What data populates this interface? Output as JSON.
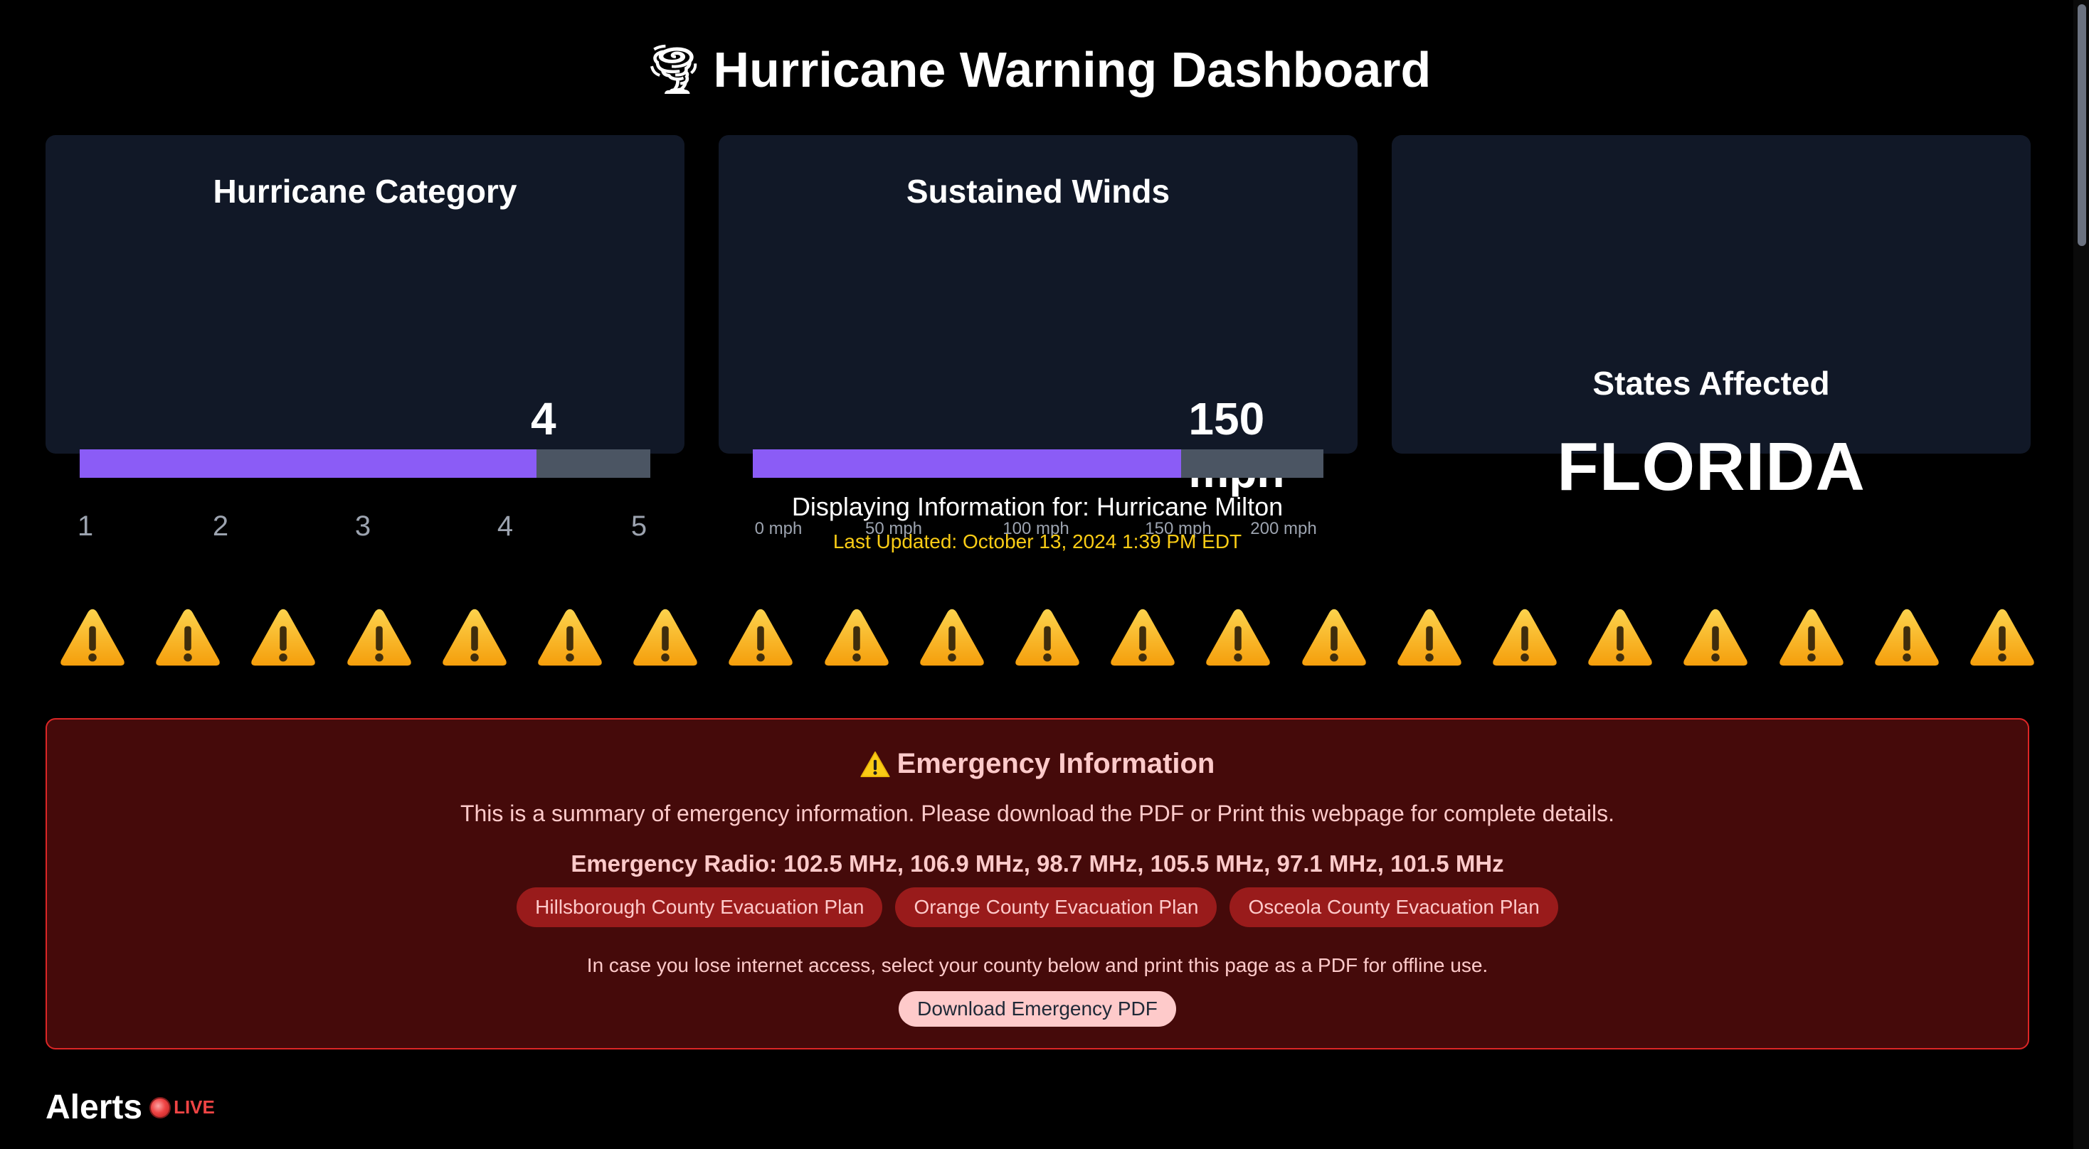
{
  "header": {
    "icon": "tornado-icon",
    "title": "Hurricane Warning Dashboard"
  },
  "category_card": {
    "title": "Hurricane Category",
    "value": "4",
    "level": 4,
    "max": 5,
    "fill_fraction": 0.8,
    "ticks": [
      "1",
      "2",
      "3",
      "4",
      "5"
    ]
  },
  "winds_card": {
    "title": "Sustained Winds",
    "value": "150 mph",
    "speed_mph": 150,
    "max_mph": 200,
    "fill_fraction": 0.75,
    "ticks": [
      "0 mph",
      "50 mph",
      "100 mph",
      "150 mph",
      "200 mph"
    ]
  },
  "states_card": {
    "label": "States Affected",
    "value": "FLORIDA"
  },
  "info": {
    "display_for": "Displaying Information for: Hurricane Milton",
    "last_updated": "Last Updated: October 13, 2024 1:39 PM EDT"
  },
  "warning_row": {
    "icon": "warning-icon",
    "count": 21
  },
  "emergency": {
    "icon": "warning-icon",
    "title": "Emergency Information",
    "summary": "This is a summary of emergency information. Please download the PDF or Print this webpage for complete details.",
    "radio": "Emergency Radio: 102.5 MHz, 106.9 MHz, 98.7 MHz, 105.5 MHz, 97.1 MHz, 101.5 MHz",
    "plans": [
      "Hillsborough County Evacuation Plan",
      "Orange County Evacuation Plan",
      "Osceola County Evacuation Plan"
    ],
    "offline_note": "In case you lose internet access, select your county below and print this page as a PDF for offline use.",
    "download_label": "Download Emergency PDF"
  },
  "alerts": {
    "title": "Alerts",
    "live_label": "LIVE",
    "live_icon": "red-circle-icon"
  },
  "colors": {
    "background": "#000000",
    "card": "#111827",
    "accent_fill": "#8b5cf6",
    "track": "#4b5563",
    "updated_text": "#facc15",
    "emergency_bg": "#450a0a",
    "emergency_border": "#dc2626",
    "pill": "#991b1b",
    "live": "#ef4444"
  }
}
